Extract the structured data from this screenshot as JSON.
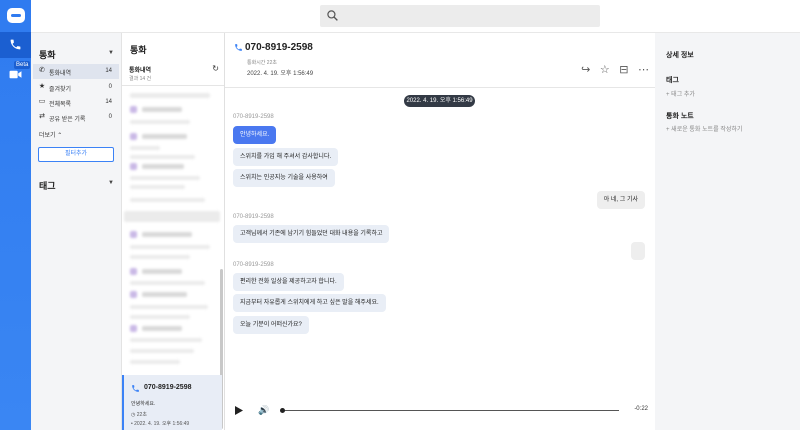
{
  "rail": {
    "beta_label": "Beta"
  },
  "search": {
    "placeholder": ""
  },
  "nav": {
    "calls_heading": "통화",
    "items": [
      {
        "label": "통화내역",
        "count": "14"
      },
      {
        "label": "즐겨찾기",
        "count": "0"
      },
      {
        "label": "전체목록",
        "count": "14"
      },
      {
        "label": "공유 받은 기록",
        "count": "0"
      }
    ],
    "more_label": "더보기",
    "filter_button": "필터추가",
    "tags_heading": "태그"
  },
  "list": {
    "title": "통화",
    "subhead": "통화내역",
    "subcount": "결과 14 건",
    "selected": {
      "number": "070-8919-2598",
      "preview": "안녕하세요.",
      "duration": "22초",
      "date": "2022. 4. 19. 오후 1:56:49"
    }
  },
  "main": {
    "number": "070-8919-2598",
    "duration": "통화시간 22초",
    "date": "2022. 4. 19. 오후 1:56:49",
    "date_pill": "2022. 4. 19. 오후 1:56:49",
    "speaker_label": "070-8919-2598",
    "messages": [
      "안녕하세요.",
      "스위치를 가입 해 주셔서 감사합니다.",
      "스위치는 인공지능 기술을 사용하여",
      "아 네, 그 기사",
      "고객님께서 기존에 남기기 힘들었던 대화 내용을 기록하고",
      "편리한 전화 일상을 제공하고자 합니다.",
      "지금부터 자유롭게 스위치에게 하고 싶은 말을 해주세요.",
      "오늘 기분이 어떠신가요?"
    ],
    "time_remaining": "-0:22"
  },
  "details": {
    "heading": "상세 정보",
    "tag_heading": "태그",
    "add_tag": "+ 태그 추가",
    "note_heading": "통화 노트",
    "add_note": "+ 새로운 통화 노트를 작성하기"
  }
}
